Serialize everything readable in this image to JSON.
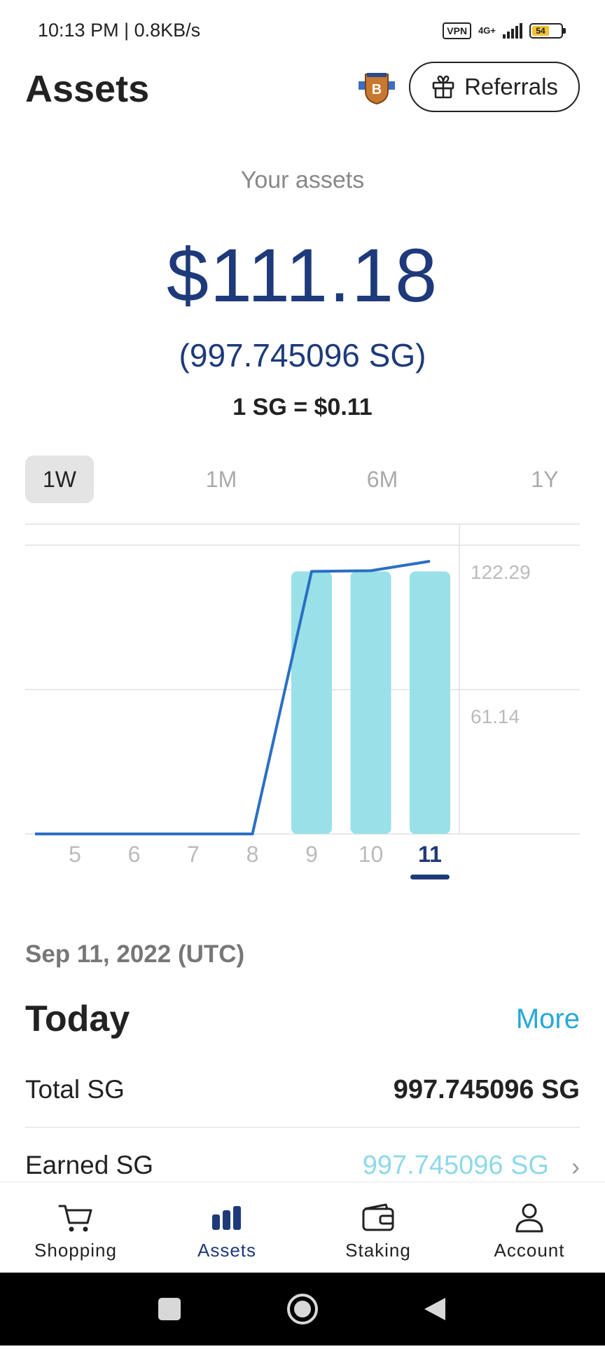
{
  "status_bar": {
    "time": "10:13 PM | 0.8KB/s",
    "vpn": "VPN",
    "network": "4G+",
    "battery": "54"
  },
  "header": {
    "title": "Assets",
    "badge_letter": "B",
    "referrals_label": "Referrals"
  },
  "summary": {
    "caption": "Your assets",
    "amount_usd": "$111.18",
    "amount_sg": "(997.745096 SG)",
    "rate": "1 SG = $0.11"
  },
  "range_tabs": [
    {
      "label": "1W",
      "active": true
    },
    {
      "label": "1M",
      "active": false
    },
    {
      "label": "6M",
      "active": false
    },
    {
      "label": "1Y",
      "active": false
    }
  ],
  "chart_data": {
    "type": "bar",
    "categories": [
      "5",
      "6",
      "7",
      "8",
      "9",
      "10",
      "11"
    ],
    "series": [
      {
        "type": "bar",
        "values": [
          0,
          0,
          0,
          0,
          111.18,
          111.18,
          111.18
        ]
      },
      {
        "type": "line",
        "values": [
          0,
          0,
          0,
          0,
          111.18,
          111.5,
          115.5
        ]
      }
    ],
    "y_ticks": [
      61.14,
      122.29
    ],
    "y_tick_labels": [
      "61.14",
      "122.29"
    ],
    "ylim": [
      0,
      122.29
    ],
    "selected_category": "11",
    "bar_color": "#9ae0e8",
    "line_color": "#2a6fc4",
    "grid": true
  },
  "details": {
    "date": "Sep 11, 2022 (UTC)",
    "section_title": "Today",
    "more_label": "More",
    "rows": [
      {
        "label": "Total SG",
        "value": "997.745096 SG"
      },
      {
        "label": "Earned SG",
        "value": "997.745096 SG"
      }
    ]
  },
  "bottom_nav": [
    {
      "label": "Shopping",
      "icon": "cart-icon",
      "active": false
    },
    {
      "label": "Assets",
      "icon": "bar-chart-icon",
      "active": true
    },
    {
      "label": "Staking",
      "icon": "wallet-icon",
      "active": false
    },
    {
      "label": "Account",
      "icon": "person-icon",
      "active": false
    }
  ],
  "colors": {
    "primary": "#1e3a7a",
    "accent": "#27a8d6",
    "bar": "#9ae0e8",
    "line": "#2a6fc4"
  }
}
